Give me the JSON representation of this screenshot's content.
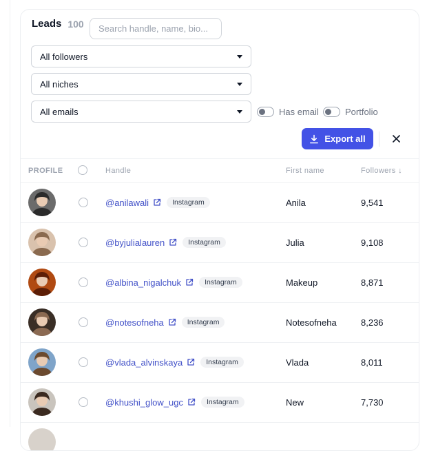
{
  "leads": {
    "title": "Leads",
    "count": "100"
  },
  "search": {
    "placeholder": "Search handle, name, bio..."
  },
  "filters": {
    "followers": "All followers",
    "niches": "All niches",
    "emails": "All emails"
  },
  "toggles": {
    "has_email": "Has email",
    "portfolio": "Portfolio"
  },
  "actions": {
    "export_all": "Export all"
  },
  "table": {
    "columns": {
      "profile": "PROFILE",
      "handle": "Handle",
      "first_name": "First name",
      "followers": "Followers ↓"
    },
    "rows": [
      {
        "handle": "@anilawali",
        "platform": "Instagram",
        "first_name": "Anila",
        "followers": "9,541",
        "avatar_bg": "#6b6b6b",
        "avatar_fg": "#2b2b2b"
      },
      {
        "handle": "@byjulialauren",
        "platform": "Instagram",
        "first_name": "Julia",
        "followers": "9,108",
        "avatar_bg": "#d9c2ad",
        "avatar_fg": "#8a6a4f"
      },
      {
        "handle": "@albina_nigalchuk",
        "platform": "Instagram",
        "first_name": "Makeup",
        "followers": "8,871",
        "avatar_bg": "#b04a12",
        "avatar_fg": "#5c1e06"
      },
      {
        "handle": "@notesofneha",
        "platform": "Instagram",
        "first_name": "Notesofneha",
        "followers": "8,236",
        "avatar_bg": "#3a2e26",
        "avatar_fg": "#8b6a52"
      },
      {
        "handle": "@vlada_alvinskaya",
        "platform": "Instagram",
        "first_name": "Vlada",
        "followers": "8,011",
        "avatar_bg": "#7fa4c9",
        "avatar_fg": "#6b4a2f"
      },
      {
        "handle": "@khushi_glow_ugc",
        "platform": "Instagram",
        "first_name": "New",
        "followers": "7,730",
        "avatar_bg": "#c9c4bd",
        "avatar_fg": "#3b2a20"
      }
    ]
  },
  "colors": {
    "accent": "#4352e6",
    "link": "#4352c8"
  }
}
